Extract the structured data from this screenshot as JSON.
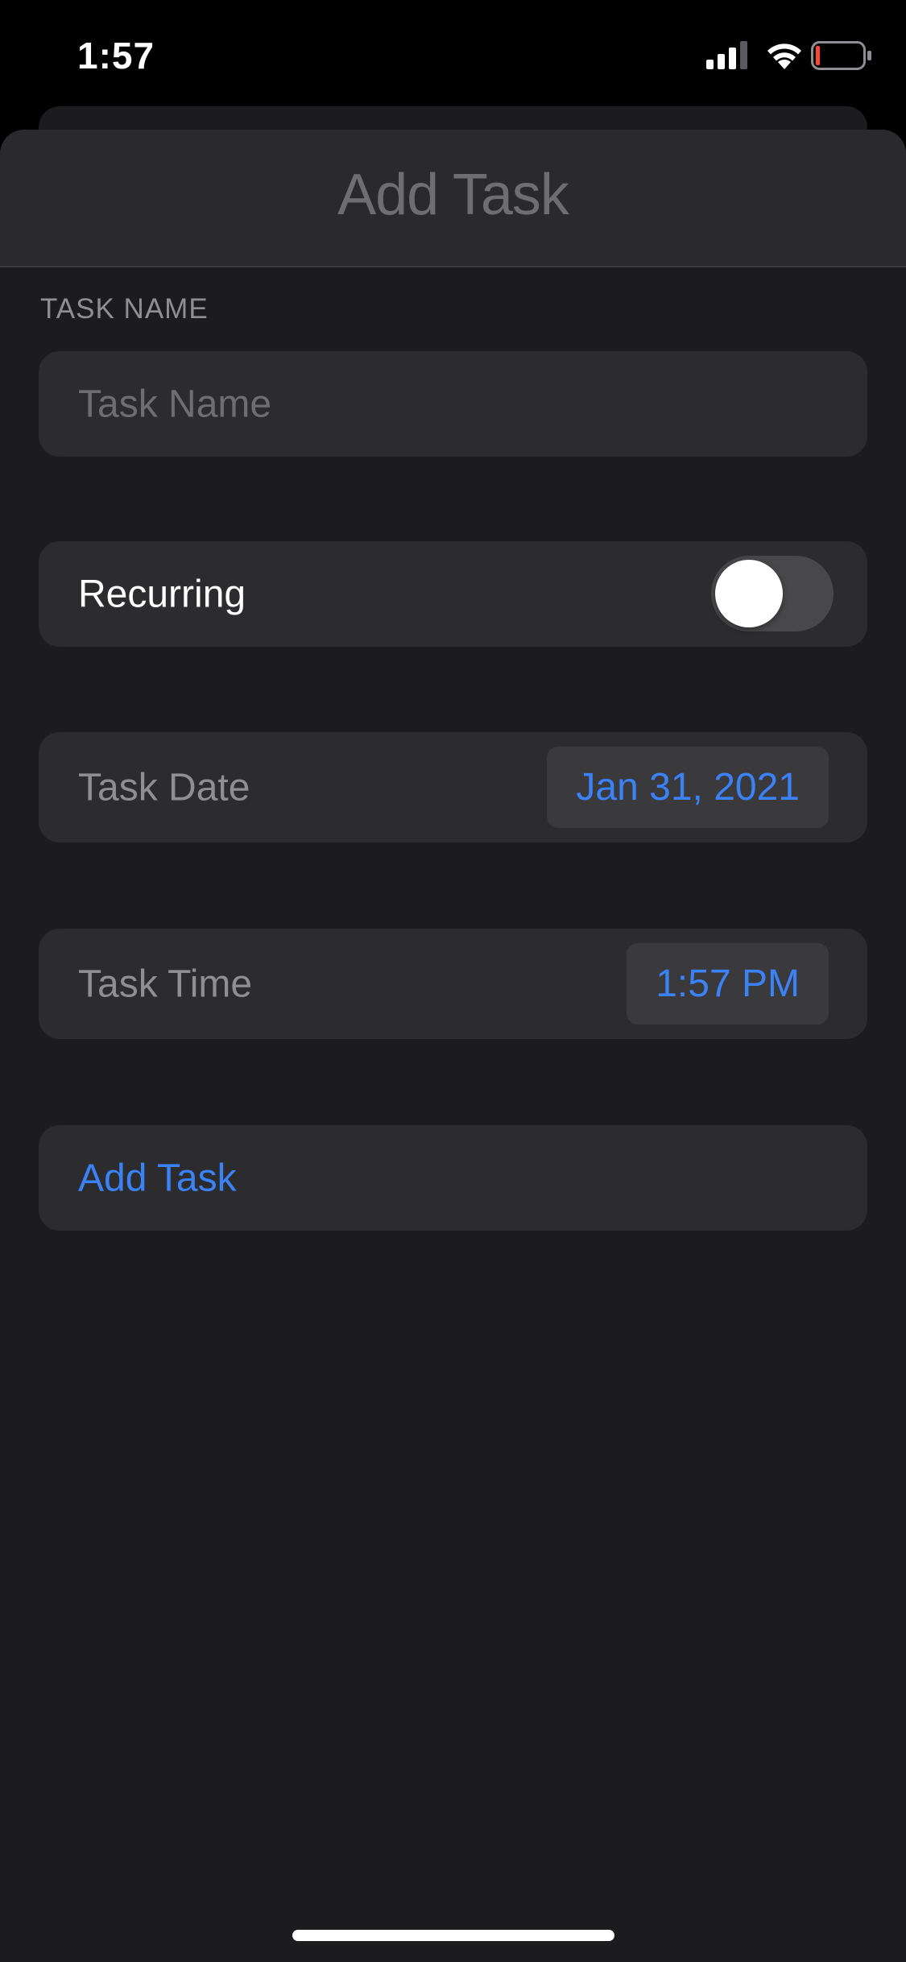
{
  "status_bar": {
    "time": "1:57",
    "icons": [
      "cellular-signal-icon",
      "wifi-icon",
      "battery-low-icon"
    ],
    "battery_color": "#ff453a"
  },
  "nav": {
    "title": "Add Task"
  },
  "form": {
    "section_header": "TASK NAME",
    "task_name": {
      "placeholder": "Task Name",
      "value": ""
    },
    "recurring": {
      "label": "Recurring",
      "on": false
    },
    "task_date": {
      "label": "Task Date",
      "value": "Jan 31, 2021"
    },
    "task_time": {
      "label": "Task Time",
      "value": "1:57 PM"
    },
    "submit_label": "Add Task"
  },
  "colors": {
    "accent": "#3b82f6",
    "background": "#1c1c1e",
    "row": "#2c2c2e"
  }
}
